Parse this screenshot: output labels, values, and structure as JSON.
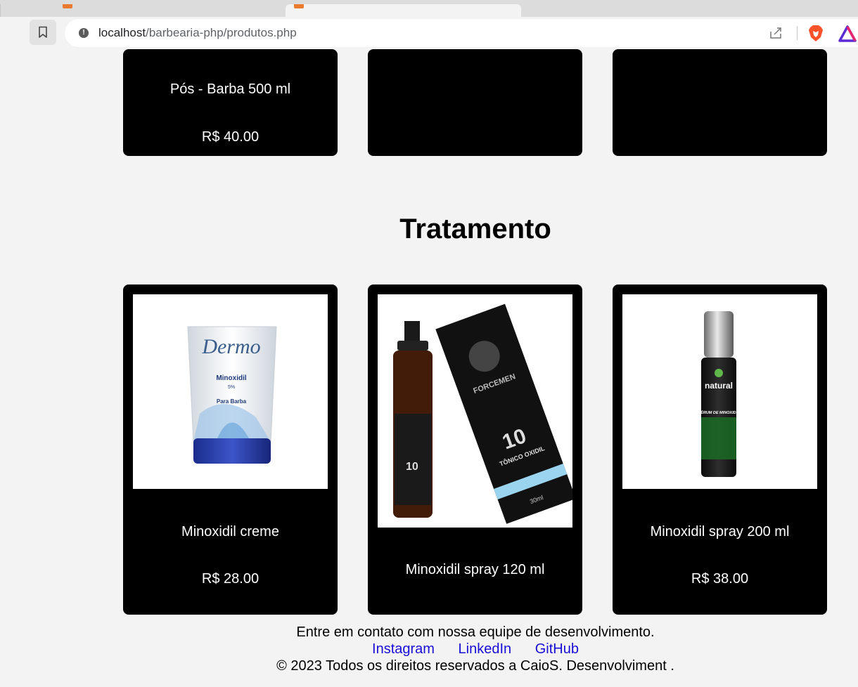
{
  "browser": {
    "url_host": "localhost",
    "url_path": "/barbearia-php/produtos.php"
  },
  "top_row": [
    {
      "name": "Pós - Barba 500 ml",
      "price": "R$ 40.00"
    },
    {
      "name": "",
      "price": ""
    },
    {
      "name": "",
      "price": ""
    }
  ],
  "section": {
    "title": "Tratamento"
  },
  "products": [
    {
      "name": "Minoxidil creme",
      "price": "R$ 28.00",
      "label_brand": "Dermo",
      "label_product": "Minoxidil",
      "label_pct": "5%",
      "label_sub": "Para Barba"
    },
    {
      "name": "Minoxidil spray 120 ml",
      "price": "",
      "label_brand": "FORCEMEN",
      "label_num": "10",
      "label_title": "TÔNICO OXIDIL",
      "label_vol": "30ml"
    },
    {
      "name": "Minoxidil spray 200 ml",
      "price": "R$ 38.00",
      "label_brand": "natural",
      "label_title": "SÉRUM DE MINOXIDIL"
    }
  ],
  "footer": {
    "contact": "Entre em contato com nossa equipe de desenvolvimento.",
    "links": [
      "Instagram",
      "LinkedIn",
      "GitHub"
    ],
    "copyright": "© 2023 Todos os direitos reservados a CaioS. Desenvolviment ."
  },
  "colors": {
    "card": "#000000",
    "page_bg": "#f3f3f3",
    "link": "#1a0dd4"
  },
  "icons": [
    "bookmark-icon",
    "info-icon",
    "share-icon",
    "brave-lion-icon",
    "brave-rewards-icon"
  ]
}
